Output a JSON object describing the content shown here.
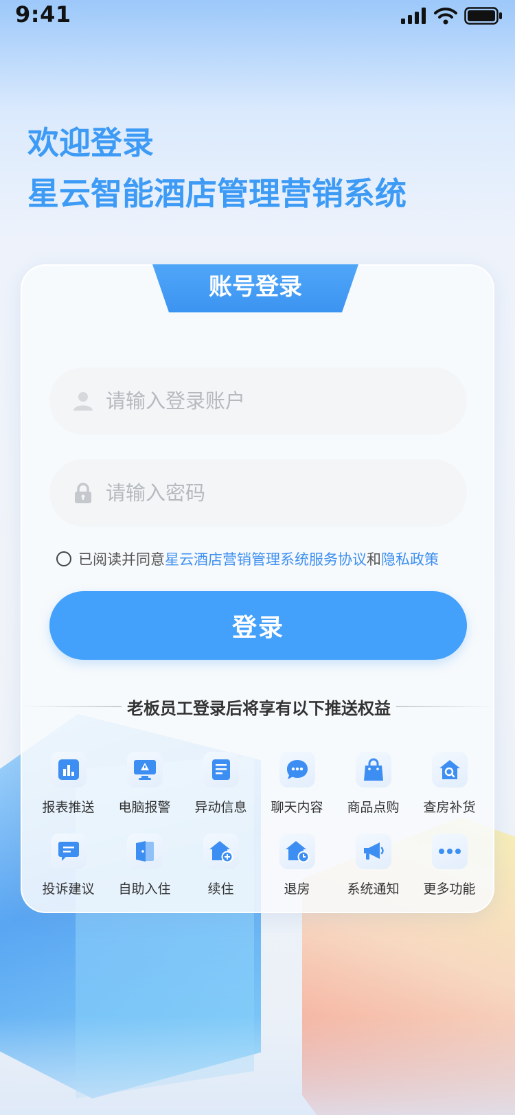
{
  "status_bar": {
    "time": "9:41"
  },
  "welcome": {
    "line1": "欢迎登录",
    "line2": "星云智能酒店管理营销系统"
  },
  "login_card": {
    "tab_label": "账号登录",
    "account_placeholder": "请输入登录账户",
    "account_value": "",
    "password_placeholder": "请输入密码",
    "password_value": "",
    "agreement": {
      "prefix": "已阅读并同意",
      "terms_link": "星云酒店营销管理系统服务协议",
      "connector": "和",
      "privacy_link": "隐私政策"
    },
    "login_button": "登录",
    "benefits_title": "老板员工登录后将享有以下推送权益"
  },
  "features": [
    {
      "label": "报表推送",
      "icon": "bar-chart-icon"
    },
    {
      "label": "电脑报警",
      "icon": "computer-alarm-icon"
    },
    {
      "label": "异动信息",
      "icon": "document-icon"
    },
    {
      "label": "聊天内容",
      "icon": "chat-bubble-icon"
    },
    {
      "label": "商品点购",
      "icon": "shopping-bag-icon"
    },
    {
      "label": "查房补货",
      "icon": "house-search-icon"
    },
    {
      "label": "投诉建议",
      "icon": "message-icon"
    },
    {
      "label": "自助入住",
      "icon": "door-icon"
    },
    {
      "label": "续住",
      "icon": "house-add-icon"
    },
    {
      "label": "退房",
      "icon": "house-clock-icon"
    },
    {
      "label": "系统通知",
      "icon": "megaphone-icon"
    },
    {
      "label": "更多功能",
      "icon": "more-dots-icon"
    }
  ],
  "colors": {
    "accent": "#43a0fb",
    "title": "#3d9bf5",
    "link": "#3d8ff0",
    "icon": "#3c8ef2"
  }
}
